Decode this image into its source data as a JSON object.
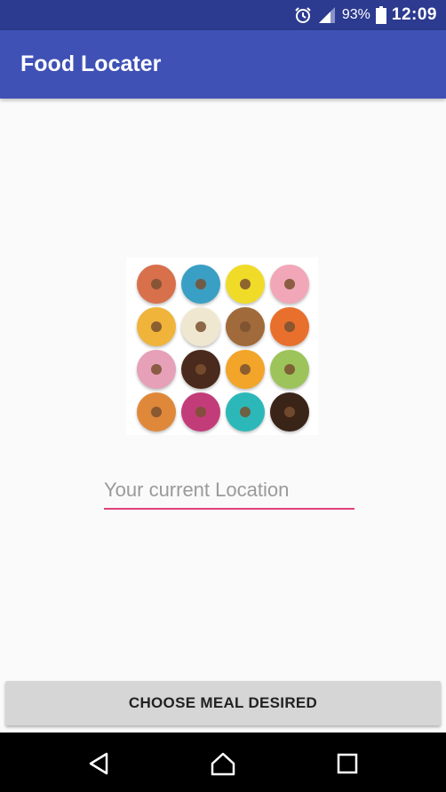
{
  "status_bar": {
    "icons": [
      "alarm-icon",
      "signal-icon",
      "battery-icon"
    ],
    "battery": "93%",
    "time": "12:09"
  },
  "app_bar": {
    "title": "Food Locater"
  },
  "main": {
    "image_icon": "donuts-image",
    "location_placeholder": "Your current Location",
    "choose_button": "CHOOSE MEAL DESIRED"
  },
  "nav_bar": {
    "icons": [
      "back-icon",
      "home-icon",
      "recents-icon"
    ]
  },
  "colors": {
    "status_bar": "#2c3a8f",
    "app_bar": "#3f51b5",
    "accent": "#e0407a",
    "button": "#d6d6d6"
  }
}
